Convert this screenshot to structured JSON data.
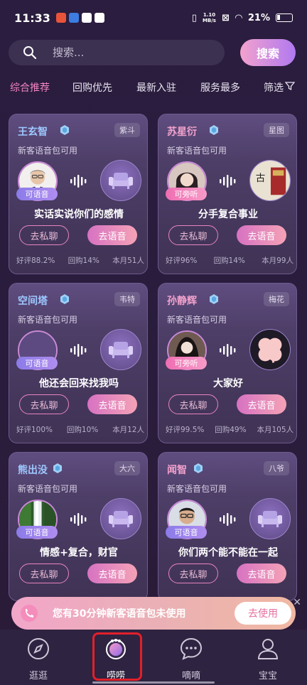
{
  "status_bar": {
    "time": "11:33",
    "net_speed_top": "1.10",
    "net_speed_bottom": "MB/s",
    "battery": "21%"
  },
  "search": {
    "placeholder": "搜索...",
    "button_label": "搜索"
  },
  "tabs": [
    "综合推荐",
    "回购优先",
    "最新入驻",
    "服务最多",
    "筛选"
  ],
  "cards": [
    {
      "name": "王玄智",
      "tag": "紫斗",
      "sub": "新客语音包可用",
      "status": "可语音",
      "status_color": "blue",
      "headline": "实话实说你们的感情",
      "chat": "去私聊",
      "voice": "去语音",
      "rating": "好评88.2%",
      "repurchase": "回购14%",
      "month": "本月51人"
    },
    {
      "name": "苏星衍",
      "tag": "星图",
      "sub": "新客语音包可用",
      "status": "可旁听",
      "status_color": "pink",
      "headline": "分手复合事业",
      "chat": "去私聊",
      "voice": "去语音",
      "rating": "好评96%",
      "repurchase": "回购14%",
      "month": "本月99人"
    },
    {
      "name": "空间塔",
      "tag": "韦特",
      "sub": "新客语音包可用",
      "status": "可语音",
      "status_color": "blue",
      "headline": "他还会回来找我吗",
      "chat": "去私聊",
      "voice": "去语音",
      "rating": "好评100%",
      "repurchase": "回购10%",
      "month": "本月12人"
    },
    {
      "name": "孙静辉",
      "tag": "梅花",
      "sub": "新客语音包可用",
      "status": "可旁听",
      "status_color": "pink",
      "headline": "大家好",
      "chat": "去私聊",
      "voice": "去语音",
      "rating": "好评99.5%",
      "repurchase": "回购49%",
      "month": "本月105人"
    },
    {
      "name": "熊出没",
      "tag": "大六",
      "sub": "新客语音包可用",
      "status": "可语音",
      "status_color": "blue",
      "headline": "情感+复合，财官",
      "chat": "去私聊",
      "voice": "去语音",
      "rating": "",
      "repurchase": "",
      "month": ""
    },
    {
      "name": "闻智",
      "tag": "八爷",
      "sub": "新客语音包可用",
      "status": "可语音",
      "status_color": "blue",
      "headline": "你们两个能不能在一起",
      "chat": "去私聊",
      "voice": "去语音",
      "rating": "",
      "repurchase": "",
      "month": ""
    }
  ],
  "banner": {
    "text": "您有30分钟新客语音包未使用",
    "button": "去使用"
  },
  "nav": [
    {
      "label": "逛逛",
      "icon": "compass-icon"
    },
    {
      "label": "唠唠",
      "icon": "chat-bubble-icon"
    },
    {
      "label": "嘀嘀",
      "icon": "message-dots-icon"
    },
    {
      "label": "宝宝",
      "icon": "user-icon"
    }
  ],
  "colors": {
    "accent_pink": "#f285c2",
    "bg": "#2b1d3f",
    "highlight_box": "#e21f2a"
  }
}
